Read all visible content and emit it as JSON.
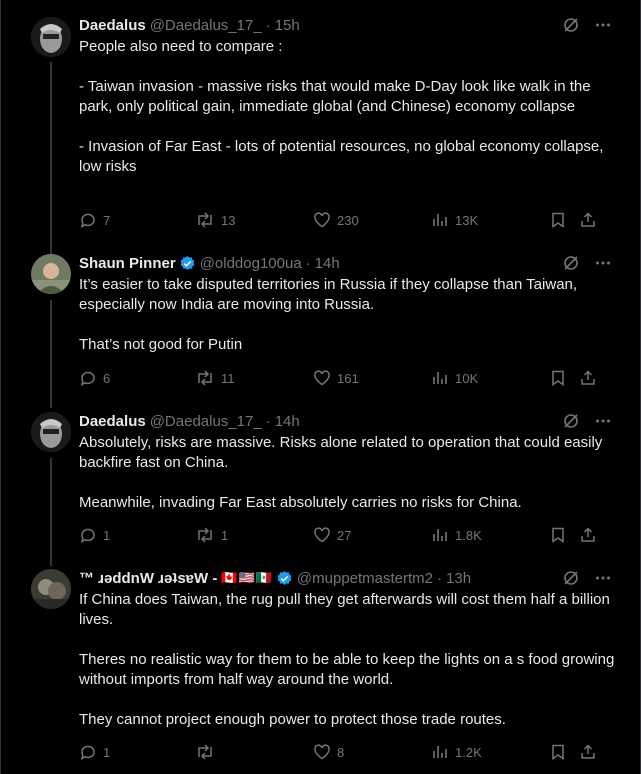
{
  "tweets": [
    {
      "name": "Daedalus",
      "handle": "@Daedalus_17_",
      "time": "15h",
      "verified": false,
      "text": "People also need to compare :\n\n- Taiwan invasion - massive risks that would make D-Day look like walk in the park, only political gain, immediate global (and Chinese) economy collapse\n\n- Invasion of Far East - lots of potential resources, no global economy collapse, low risks",
      "replies": "7",
      "reposts": "13",
      "likes": "230",
      "views": "13K"
    },
    {
      "name": "Shaun Pinner",
      "handle": "@olddog100ua",
      "time": "14h",
      "verified": true,
      "text": "It’s easier to take disputed territories in Russia if they collapse than Taiwan, especially now India are moving into Russia.\n\nThat’s not good for Putin",
      "replies": "6",
      "reposts": "11",
      "likes": "161",
      "views": "10K"
    },
    {
      "name": "Daedalus",
      "handle": "@Daedalus_17_",
      "time": "14h",
      "verified": false,
      "text": "Absolutely, risks are massive. Risks alone related to operation that could easily backfire fast on China.\n\nMeanwhile, invading Far East absolutely carries no risks for China.",
      "replies": "1",
      "reposts": "1",
      "likes": "27",
      "views": "1.8K"
    },
    {
      "name": "™ ɹǝddnW ɹǝʇsɐW -",
      "flags": "🇨🇦🇺🇸🇲🇽",
      "handle": "@muppetmastertm2",
      "time": "13h",
      "verified": true,
      "text": "If China does Taiwan, the rug pull they get afterwards will cost them half a billion lives.\n\nTheres no realistic way for them to be able to keep the lights on a s food growing without imports from half way around the world.\n\nThey cannot project enough power to protect those trade routes.",
      "replies": "1",
      "reposts": "",
      "likes": "8",
      "views": "1.2K"
    }
  ],
  "colors": {
    "background": "#000000",
    "text": "#e7e9ea",
    "muted": "#71767b",
    "verified": "#1d9bf0"
  },
  "icons": [
    "grok-icon",
    "more-icon",
    "reply-icon",
    "repost-icon",
    "like-icon",
    "views-icon",
    "bookmark-icon",
    "share-icon",
    "verified-badge-icon"
  ]
}
